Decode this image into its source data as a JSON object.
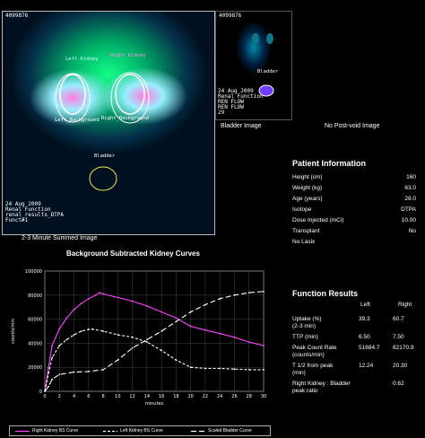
{
  "main_image": {
    "id": "4099876",
    "left_kidney_label": "Left Kidney",
    "right_kidney_label": "Right Kidney",
    "left_background_label": "Left_Background",
    "right_background_label": "Right_Background",
    "bladder_label": "Bladder",
    "date": "24 Aug 2009",
    "line2": "Renal Function",
    "line3": "renal_results_DTPA",
    "line4": "Funct#1",
    "caption": "2-3 Minute Summed Image"
  },
  "bladder_image": {
    "id": "4099876",
    "bladder_label": "Bladder",
    "date": "24 Aug 2009",
    "line2": "Renal Function",
    "line3": "REN FLOW",
    "line4": "REN FLOW",
    "line5": "29",
    "caption": "Bladder Image"
  },
  "post_void_caption": "No Post-void Image",
  "patient_info": {
    "title": "Patient Information",
    "rows": [
      {
        "label": "Height (cm)",
        "value": "160"
      },
      {
        "label": "Weight (kg)",
        "value": "63.0"
      },
      {
        "label": "Age (years)",
        "value": "28.0"
      },
      {
        "label": "Isotope",
        "value": "DTPA"
      },
      {
        "label": "Dose Injected (mCi)",
        "value": "10.00"
      },
      {
        "label": "Transplant",
        "value": "No"
      },
      {
        "label": "No Lasix",
        "value": ""
      }
    ]
  },
  "function_results": {
    "title": "Function Results",
    "col_left": "Left",
    "col_right": "Right",
    "rows": [
      {
        "label": "Uptake (%)\n(2-3 min)",
        "left": "39.3",
        "right": "60.7"
      },
      {
        "label": "TTP (min)",
        "left": "6.50",
        "right": "7.50"
      },
      {
        "label": "Peak Count Rate\n(counts/min)",
        "left": "51684.7",
        "right": "82170.9"
      },
      {
        "label": "T 1/2 from peak\n(min)",
        "left": "12.24",
        "right": "20.30"
      },
      {
        "label": "Right Kidney : Bladder\npeak ratio",
        "left": "",
        "right": "0.62"
      }
    ]
  },
  "chart_data": {
    "type": "line",
    "title": "Background Subtracted Kidney Curves",
    "xlabel": "minutes",
    "ylabel": "counts/min",
    "xlim": [
      0,
      30
    ],
    "ylim": [
      0,
      100000
    ],
    "x_ticks": [
      0,
      2,
      4,
      6,
      8,
      10,
      12,
      14,
      16,
      18,
      20,
      22,
      24,
      26,
      28,
      30
    ],
    "y_ticks": [
      0,
      20000,
      40000,
      60000,
      80000,
      100000
    ],
    "y_tick_labels": [
      "0",
      "20000",
      "40000",
      "60000",
      "80000",
      "100000"
    ],
    "grid": true,
    "legend_position": "bottom",
    "series": [
      {
        "name": "Right Kidney BS Curve",
        "color": "#ff44ff",
        "dash": "solid",
        "x": [
          0,
          0.5,
          1,
          2,
          3,
          4,
          5,
          6,
          7,
          7.5,
          8,
          10,
          12,
          14,
          16,
          18,
          20,
          22,
          24,
          26,
          28,
          30
        ],
        "y": [
          0,
          20000,
          38000,
          52000,
          61000,
          68000,
          73000,
          77000,
          80000,
          82000,
          81000,
          78000,
          75000,
          71000,
          66000,
          61000,
          54000,
          51000,
          48000,
          45000,
          41000,
          38000
        ]
      },
      {
        "name": "Left Kidney BS Curve",
        "color": "#ffffff",
        "dash": "3,2",
        "x": [
          0,
          0.5,
          1,
          2,
          3,
          4,
          5,
          6,
          6.5,
          8,
          10,
          12,
          14,
          16,
          18,
          20,
          22,
          24,
          26,
          28,
          30
        ],
        "y": [
          0,
          15000,
          28000,
          38000,
          43000,
          47000,
          50000,
          51500,
          51700,
          50000,
          47000,
          45000,
          41000,
          34000,
          26000,
          20000,
          19000,
          19000,
          18500,
          18000,
          18000
        ]
      },
      {
        "name": "Scaled Bladder Curve",
        "color": "#ffffff",
        "dash": "6,3",
        "x": [
          0,
          0.5,
          1,
          2,
          4,
          6,
          8,
          10,
          12,
          14,
          16,
          18,
          20,
          22,
          24,
          26,
          28,
          30
        ],
        "y": [
          0,
          4000,
          10000,
          14000,
          16000,
          16500,
          18000,
          26000,
          36000,
          43000,
          50000,
          58000,
          66000,
          72000,
          77000,
          80000,
          82000,
          83000
        ]
      }
    ]
  }
}
